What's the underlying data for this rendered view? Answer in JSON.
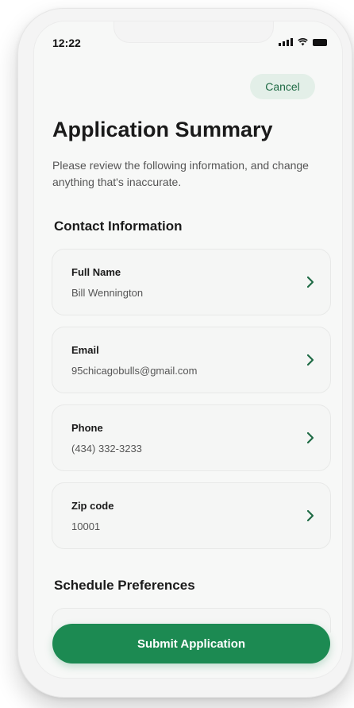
{
  "status": {
    "time": "12:22"
  },
  "header": {
    "cancel_label": "Cancel",
    "title": "Application Summary",
    "description": "Please review the following information, and change anything that's inaccurate."
  },
  "sections": {
    "contact": "Contact Information",
    "schedule": "Schedule Preferences"
  },
  "fields": [
    {
      "label": "Full Name",
      "value": "Bill Wennington"
    },
    {
      "label": "Email",
      "value": "95chicagobulls@gmail.com"
    },
    {
      "label": "Phone",
      "value": "(434) 332-3233"
    },
    {
      "label": "Zip code",
      "value": "10001"
    }
  ],
  "footer": {
    "submit_label": "Submit Application"
  },
  "colors": {
    "accent": "#1c8a52",
    "cancel_bg": "#e3efe8"
  }
}
